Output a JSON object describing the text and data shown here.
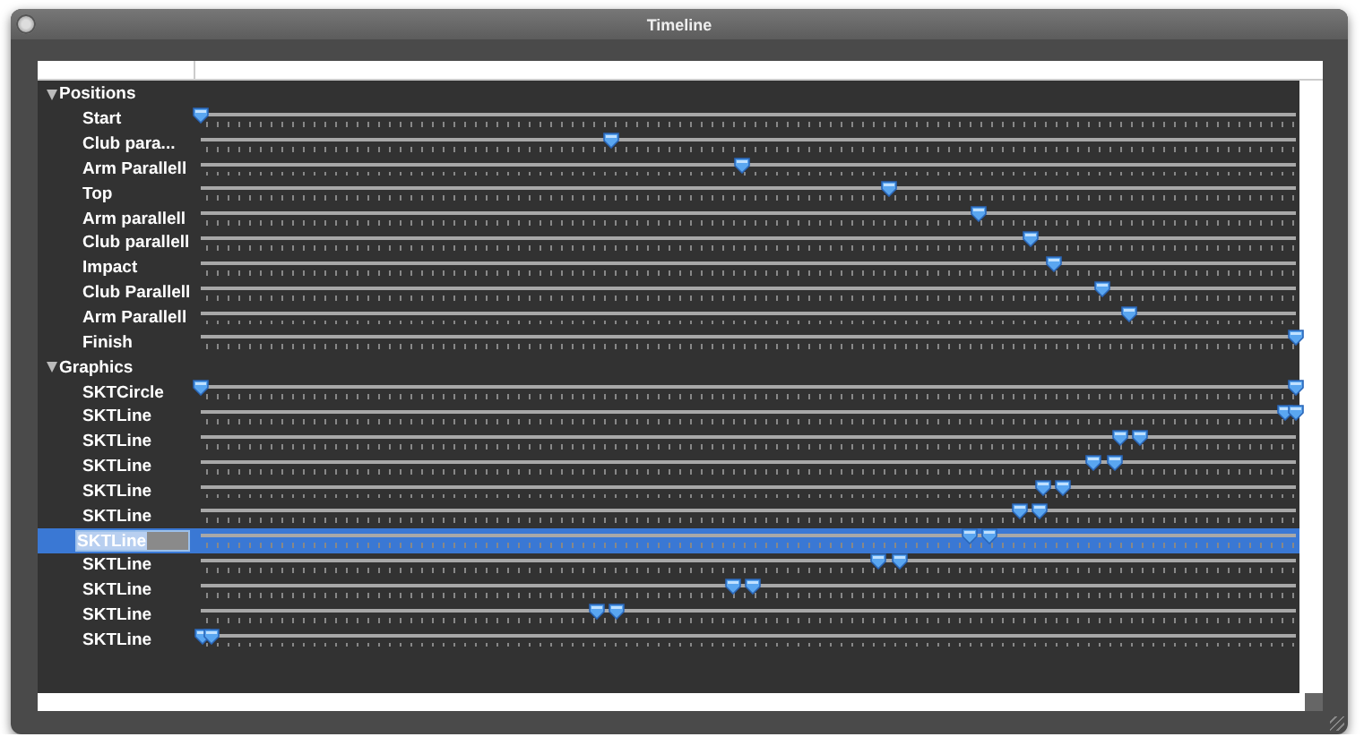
{
  "window": {
    "title": "Timeline"
  },
  "groups": [
    {
      "label": "Positions",
      "expanded": true,
      "items": [
        {
          "label": "Start",
          "selected": false,
          "thumbs": [
            {
              "level": 0
            }
          ]
        },
        {
          "label": "Club para...",
          "selected": false,
          "thumbs": [
            {
              "level": 0.374
            }
          ]
        },
        {
          "label": "Arm Parallell",
          "selected": false,
          "thumbs": [
            {
              "level": 0.494
            }
          ]
        },
        {
          "label": "Top",
          "selected": false,
          "thumbs": [
            {
              "level": 0.628
            }
          ]
        },
        {
          "label": "Arm parallell",
          "selected": false,
          "thumbs": [
            {
              "level": 0.71
            }
          ]
        },
        {
          "label": "Club parallell",
          "selected": false,
          "thumbs": [
            {
              "level": 0.758
            }
          ]
        },
        {
          "label": "Impact",
          "selected": false,
          "thumbs": [
            {
              "level": 0.779
            }
          ]
        },
        {
          "label": "Club Parallell",
          "selected": false,
          "thumbs": [
            {
              "level": 0.824
            }
          ]
        },
        {
          "label": "Arm Parallell",
          "selected": false,
          "thumbs": [
            {
              "level": 0.847
            }
          ]
        },
        {
          "label": "Finish",
          "selected": false,
          "thumbs": [
            {
              "level": 1
            }
          ]
        }
      ]
    },
    {
      "label": "Graphics",
      "expanded": true,
      "items": [
        {
          "label": "SKTCircle",
          "selected": false,
          "thumbs": [
            {
              "level": 0
            },
            {
              "level": 1
            }
          ]
        },
        {
          "label": "SKTLine",
          "selected": false,
          "thumbs": [
            {
              "level": 0.99
            },
            {
              "level": 1
            }
          ]
        },
        {
          "label": "SKTLine",
          "selected": false,
          "thumbs": [
            {
              "level": 0.84
            },
            {
              "level": 0.857
            }
          ]
        },
        {
          "label": "SKTLine",
          "selected": false,
          "thumbs": [
            {
              "level": 0.815
            },
            {
              "level": 0.834
            }
          ]
        },
        {
          "label": "SKTLine",
          "selected": false,
          "thumbs": [
            {
              "level": 0.769
            },
            {
              "level": 0.787
            }
          ]
        },
        {
          "label": "SKTLine",
          "selected": false,
          "thumbs": [
            {
              "level": 0.748
            },
            {
              "level": 0.766
            }
          ]
        },
        {
          "label": "SKTLine",
          "selected": true,
          "thumbs": [
            {
              "level": 0.702
            },
            {
              "level": 0.72
            }
          ]
        },
        {
          "label": "SKTLine",
          "selected": false,
          "thumbs": [
            {
              "level": 0.619
            },
            {
              "level": 0.638
            }
          ]
        },
        {
          "label": "SKTLine",
          "selected": false,
          "thumbs": [
            {
              "level": 0.486
            },
            {
              "level": 0.504
            }
          ]
        },
        {
          "label": "SKTLine",
          "selected": false,
          "thumbs": [
            {
              "level": 0.362
            },
            {
              "level": 0.38
            }
          ]
        },
        {
          "label": "SKTLine",
          "selected": false,
          "thumbs": [
            {
              "level": 0.002
            },
            {
              "level": 0.01
            }
          ]
        }
      ]
    }
  ]
}
